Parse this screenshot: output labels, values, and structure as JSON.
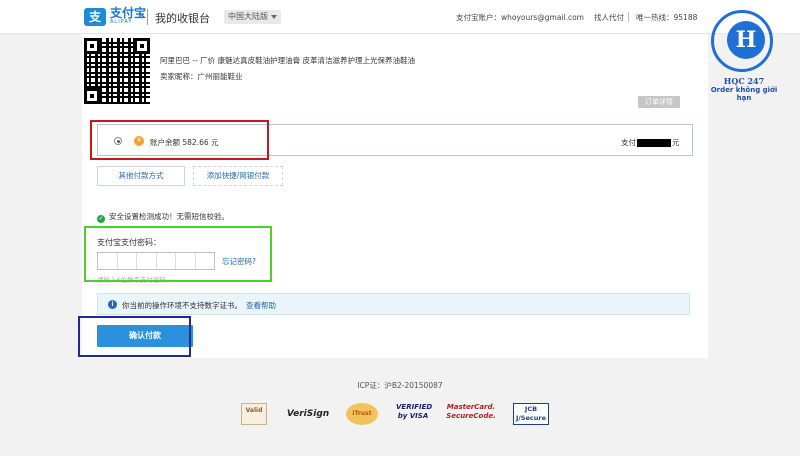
{
  "header": {
    "logo_char": "支",
    "logo_cn": "支付宝",
    "logo_en": "ALIPAY",
    "title": "我的收银台",
    "region": "中国大陆版",
    "account": "支付宝账户：whoyours@gmail.com",
    "proxy": "找人代付",
    "hotline": "唯一热线：95188"
  },
  "order": {
    "name": "阿里巴巴 -- 厂价 康魅达真皮鞋油护理油膏 皮革清洁滋养护理上光保养油鞋油",
    "seller": "卖家昵称：广州丽能鞋业",
    "detail_tab": "订单详情"
  },
  "payment": {
    "balance_icon": "¥",
    "balance": "账户余额 582.66 元",
    "pay_label": "支付",
    "pay_suffix": "元"
  },
  "buttons": {
    "other_methods": "其他付款方式",
    "add_card": "添加快捷/网银付款",
    "confirm": "确认付款"
  },
  "security": {
    "check_mark": "✓",
    "message": "安全设置检测成功！无需短信校验。"
  },
  "password": {
    "label": "支付宝支付密码：",
    "forgot": "忘记密码?",
    "hint": "请输入6位数字支付密码"
  },
  "cert": {
    "info_mark": "i",
    "text": "你当前的操作环境不支持数字证书。",
    "help": "查看帮助"
  },
  "footer": {
    "icp": "ICP证：沪B2-20150087",
    "badges": [
      "Valid",
      "VeriSign",
      "iTrust",
      "VERIFIED by VISA",
      "MasterCard. SecureCode.",
      "JCB J/Secure"
    ]
  },
  "watermark": {
    "letter": "H",
    "name": "HQC 247",
    "tagline": "Order không giới hạn"
  },
  "colors": {
    "alipay_blue": "#1e8bd6",
    "confirm_blue": "#2c91dd",
    "red_highlight": "#c8161d",
    "green_highlight": "#4bd12b",
    "navy_highlight": "#1f2b8f"
  }
}
